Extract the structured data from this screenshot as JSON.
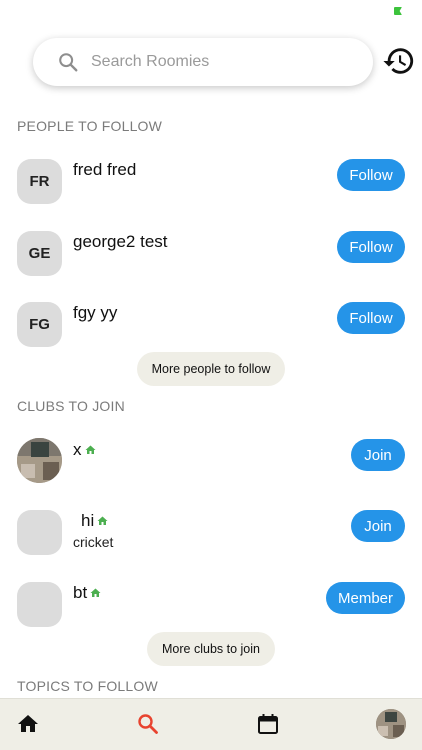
{
  "search": {
    "placeholder": "Search Roomies"
  },
  "icons": {
    "search": "search-icon",
    "history": "history-icon",
    "home": "home-icon",
    "calendar": "calendar-icon",
    "club_home": "house-icon"
  },
  "colors": {
    "accent": "#2594e8",
    "house_green": "#4caf50",
    "nav_bg": "#efeee6",
    "active_search": "#e8432f"
  },
  "people_section": {
    "title": "PEOPLE TO FOLLOW",
    "items": [
      {
        "initials": "FR",
        "name": "fred fred",
        "action": "Follow"
      },
      {
        "initials": "GE",
        "name": "george2 test",
        "action": "Follow"
      },
      {
        "initials": "FG",
        "name": "fgy yy",
        "action": "Follow"
      }
    ],
    "more_label": "More people to follow"
  },
  "clubs_section": {
    "title": "CLUBS TO JOIN",
    "items": [
      {
        "name": "x",
        "subtitle": "",
        "action": "Join"
      },
      {
        "name": "hi",
        "subtitle": "cricket",
        "action": "Join"
      },
      {
        "name": "bt",
        "subtitle": "",
        "action": "Member"
      }
    ],
    "more_label": "More clubs to join"
  },
  "topics_section": {
    "title": "TOPICS TO FOLLOW"
  }
}
